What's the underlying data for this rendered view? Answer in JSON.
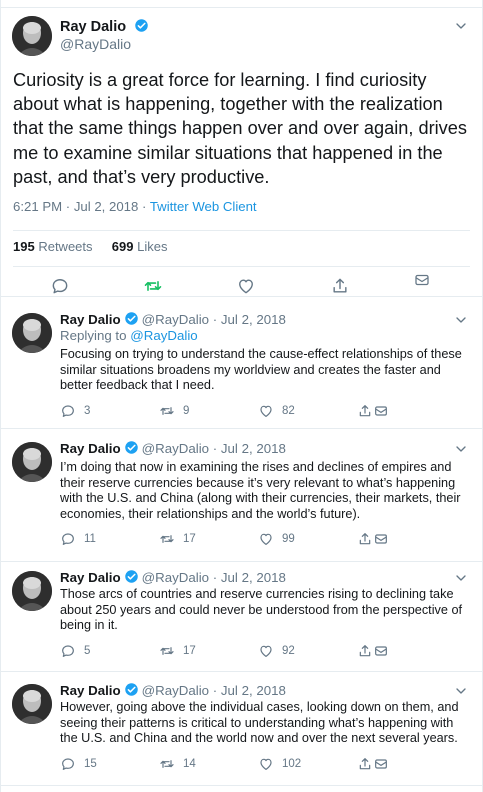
{
  "main_tweet": {
    "author_name": "Ray Dalio",
    "author_handle": "@RayDalio",
    "text": "Curiosity is a great force for learning. I find curiosity about what is happening, together with the realization that the same things happen over and over again, drives me to examine similar situations that happened in the past, and that’s very productive.",
    "time": "6:21 PM · Jul 2, 2018 · ",
    "client": "Twitter Web Client",
    "retweets_count": "195",
    "retweets_label": "Retweets",
    "likes_count": "699",
    "likes_label": "Likes"
  },
  "replies": [
    {
      "author_name": "Ray Dalio",
      "author_handle": "@RayDalio · Jul 2, 2018",
      "replying_prefix": "Replying to ",
      "replying_handle": "@RayDalio",
      "text": "Focusing on trying to understand the cause-effect relationships of these similar situations broadens my worldview and creates the faster and better feedback that I need.",
      "reply_count": "3",
      "retweet_count": "9",
      "like_count": "82"
    },
    {
      "author_name": "Ray Dalio",
      "author_handle": "@RayDalio · Jul 2, 2018",
      "text": "I’m doing that now in examining the rises and declines of empires and their reserve currencies because it’s very relevant to what’s happening with the U.S. and China (along with their currencies, their markets, their economies, their relationships and the world’s future).",
      "reply_count": "11",
      "retweet_count": "17",
      "like_count": "99"
    },
    {
      "author_name": "Ray Dalio",
      "author_handle": "@RayDalio · Jul 2, 2018",
      "text": "Those arcs of countries and reserve currencies rising to declining take about 250 years and could never be understood from the perspective of being in it.",
      "reply_count": "5",
      "retweet_count": "17",
      "like_count": "92"
    },
    {
      "author_name": "Ray Dalio",
      "author_handle": "@RayDalio · Jul 2, 2018",
      "text": "However, going above the individual cases, looking down on them, and seeing their patterns is critical to understanding what’s happening with the U.S. and China and the world now and over the next several years.",
      "reply_count": "15",
      "retweet_count": "14",
      "like_count": "102"
    }
  ],
  "icons": {
    "verified": "verified-badge-icon",
    "reply": "reply-icon",
    "retweet": "retweet-icon",
    "like": "heart-icon",
    "share": "share-icon",
    "dm": "direct-message-icon",
    "caret": "chevron-down-icon"
  },
  "colors": {
    "accent": "#1b95e0",
    "retweet_green": "#17bf63",
    "muted": "#657786",
    "border": "#e6ecf0"
  }
}
